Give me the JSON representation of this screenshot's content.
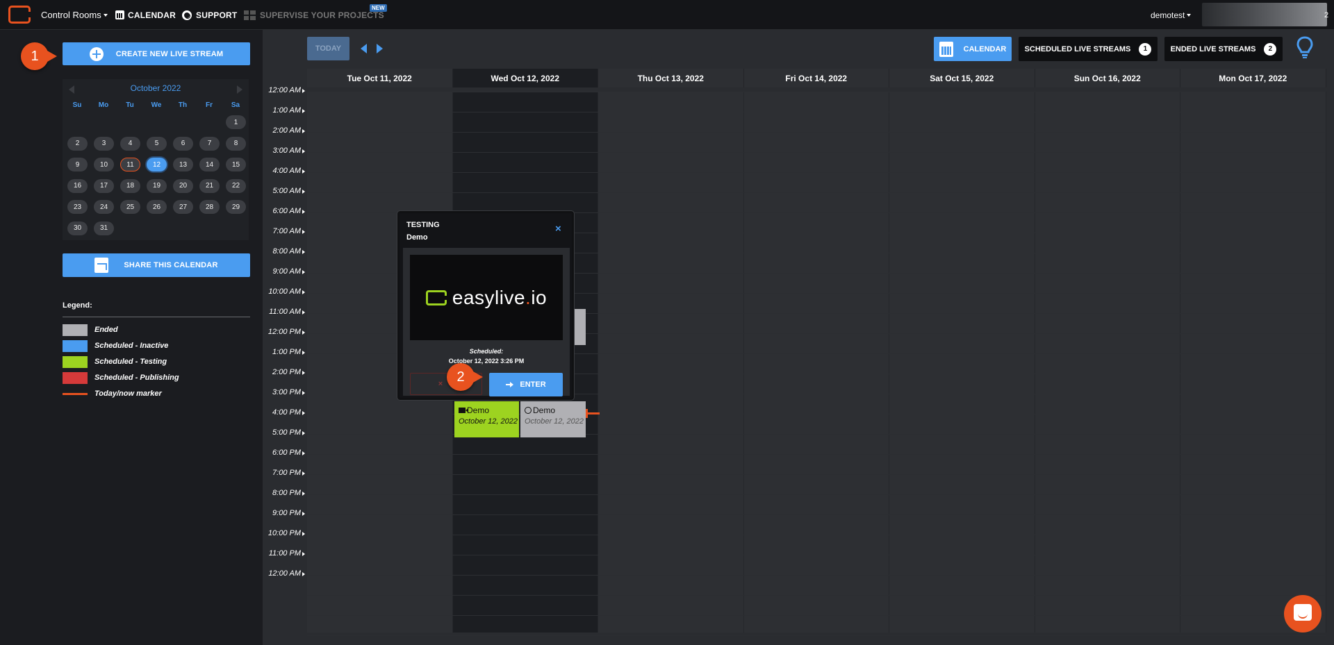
{
  "navbar": {
    "rooms": "Control Rooms",
    "calendar": "CALENDAR",
    "support": "SUPPORT",
    "supervise": "SUPERVISE YOUR PROJECTS",
    "new_badge": "NEW",
    "user": "demotest",
    "user_suffix": "2"
  },
  "sidebar": {
    "create_button": "CREATE NEW LIVE STREAM",
    "step1": "1",
    "minical": {
      "month": "October 2022",
      "dow": [
        "Su",
        "Mo",
        "Tu",
        "We",
        "Th",
        "Fr",
        "Sa"
      ],
      "days": [
        "1",
        "2",
        "3",
        "4",
        "5",
        "6",
        "7",
        "8",
        "9",
        "10",
        "11",
        "12",
        "13",
        "14",
        "15",
        "16",
        "17",
        "18",
        "19",
        "20",
        "21",
        "22",
        "23",
        "24",
        "25",
        "26",
        "27",
        "28",
        "29",
        "30",
        "31"
      ],
      "selected_day": "12",
      "today_day": "11"
    },
    "share_button": "SHARE THIS CALENDAR",
    "legend": {
      "title": "Legend:",
      "items": [
        {
          "label": "Ended",
          "color": "#b0b0b4"
        },
        {
          "label": "Scheduled - Inactive",
          "color": "#4a9cf0"
        },
        {
          "label": "Scheduled - Testing",
          "color": "#9dd320"
        },
        {
          "label": "Scheduled - Publishing",
          "color": "#d63a3a"
        },
        {
          "label": "Today/now marker",
          "color": "#e8521f"
        }
      ]
    }
  },
  "toolbar": {
    "today": "TODAY",
    "calendar": "CALENDAR",
    "scheduled": "SCHEDULED LIVE STREAMS",
    "scheduled_count": "1",
    "ended": "ENDED LIVE STREAMS",
    "ended_count": "2"
  },
  "calendar": {
    "days": [
      "Tue Oct 11, 2022",
      "Wed Oct 12, 2022",
      "Thu Oct 13, 2022",
      "Fri Oct 14, 2022",
      "Sat Oct 15, 2022",
      "Sun Oct 16, 2022",
      "Mon Oct 17, 2022"
    ],
    "hours": [
      "12:00 AM",
      "1:00 AM",
      "2:00 AM",
      "3:00 AM",
      "4:00 AM",
      "5:00 AM",
      "6:00 AM",
      "7:00 AM",
      "8:00 AM",
      "9:00 AM",
      "10:00 AM",
      "11:00 AM",
      "12:00 PM",
      "1:00 PM",
      "2:00 PM",
      "3:00 PM",
      "4:00 PM",
      "5:00 PM",
      "6:00 PM",
      "7:00 PM",
      "8:00 PM",
      "9:00 PM",
      "10:00 PM",
      "11:00 PM",
      "12:00 AM"
    ],
    "events": [
      {
        "title": "Demo",
        "date": "October 12, 2022",
        "status": "Scheduled - Testing",
        "color": "#9dd320"
      },
      {
        "title": "Demo",
        "date": "October 12, 2022",
        "status": "Ended",
        "color": "#b0b0b4"
      }
    ]
  },
  "popup": {
    "status": "TESTING",
    "title": "Demo",
    "close": "×",
    "brand_a": "easylive",
    "brand_dot": ".",
    "brand_b": "io",
    "scheduled_label": "Scheduled:",
    "scheduled_value": "October 12, 2022 3:26 PM",
    "cancel": "C",
    "cancel_icon": "×",
    "enter": "ENTER",
    "step2": "2"
  }
}
